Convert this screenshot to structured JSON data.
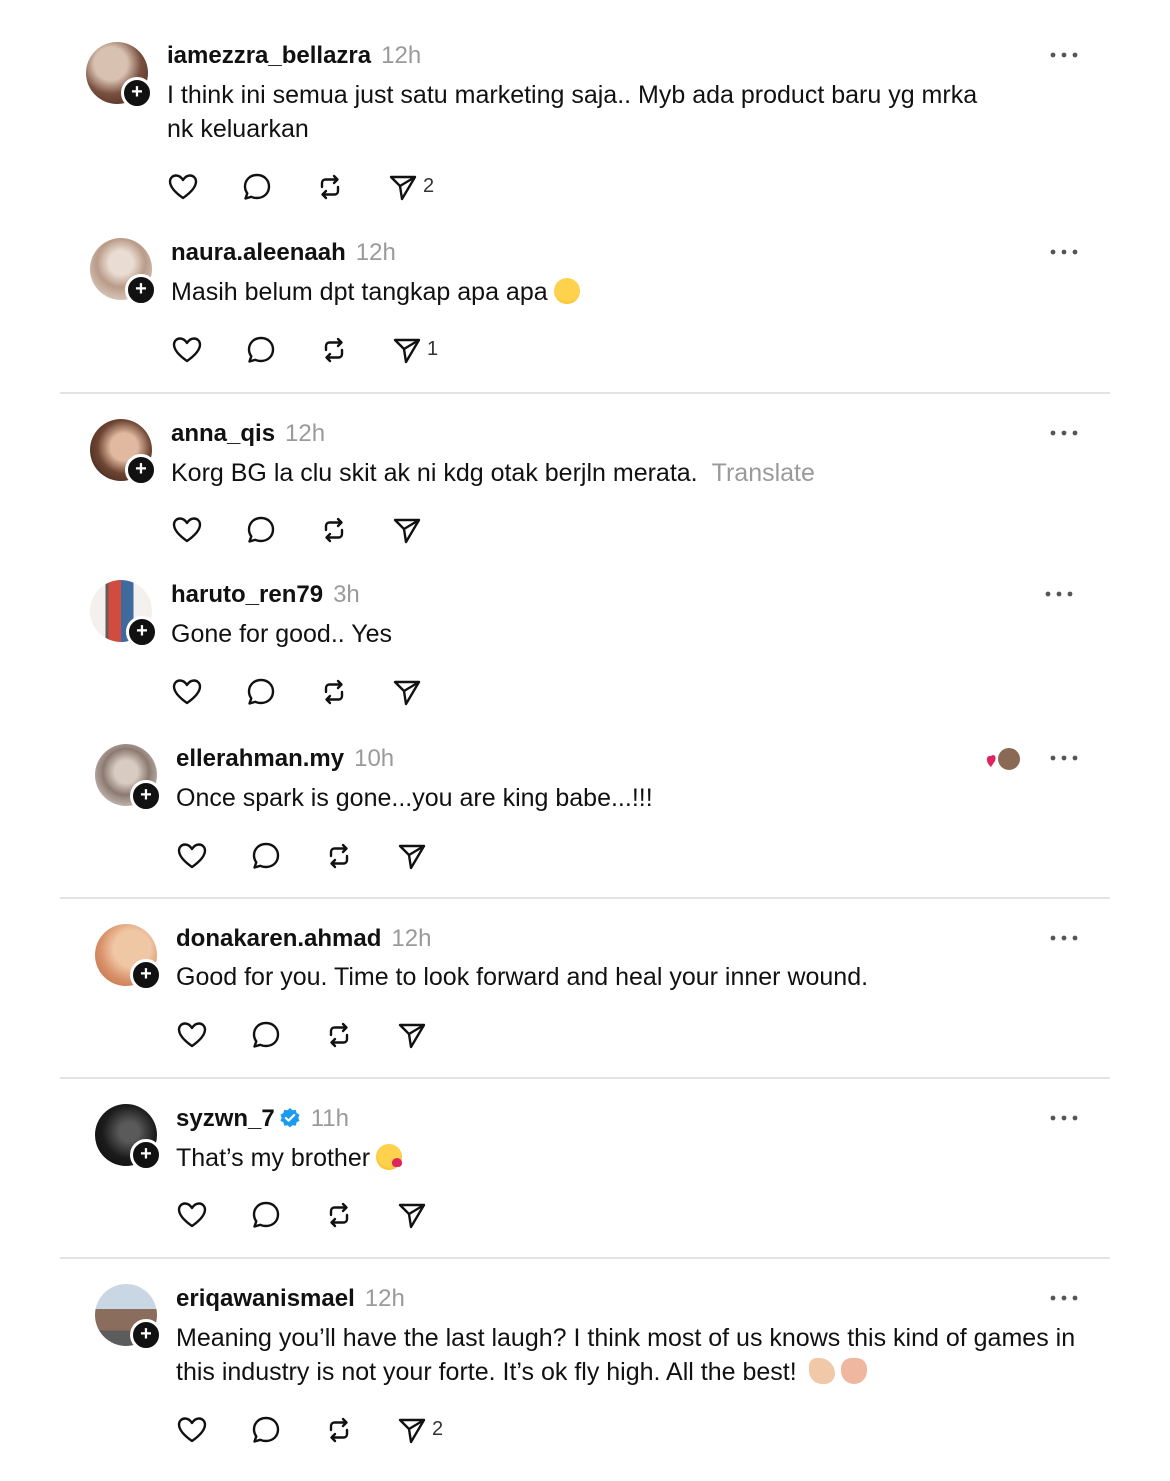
{
  "posts": [
    {
      "username": "iamezzra_bellazra",
      "time": "12h",
      "text": "I think ini semua just satu marketing saja.. Myb ada product baru yg mrka nk keluarkan",
      "share_count": "2"
    },
    {
      "username": "naura.aleenaah",
      "time": "12h",
      "text": "Masih belum dpt tangkap apa apa",
      "share_count": "1"
    },
    {
      "username": "anna_qis",
      "time": "12h",
      "text": "Korg BG la clu skit ak ni kdg otak berjln merata.",
      "translate": "Translate",
      "share_count": ""
    },
    {
      "username": "haruto_ren79",
      "time": "3h",
      "text": "Gone for good.. Yes",
      "share_count": ""
    },
    {
      "username": "ellerahman.my",
      "time": "10h",
      "text": "Once spark is gone...you are king babe...!!!",
      "share_count": ""
    },
    {
      "username": "donakaren.ahmad",
      "time": "12h",
      "text": "Good for you. Time to look forward and heal your inner wound.",
      "share_count": ""
    },
    {
      "username": "syzwn_7",
      "time": "11h",
      "text": "That’s my brother",
      "share_count": ""
    },
    {
      "username": "eriqawanismael",
      "time": "12h",
      "text": "Meaning you’ll have the last laugh? I think most of us knows this kind of games in this industry is not your forte. It’s ok fly high. All the best!",
      "share_count": "2"
    }
  ],
  "icons": {
    "like": "heart-icon",
    "reply": "comment-icon",
    "repost": "repost-icon",
    "share": "send-icon",
    "more": "more-icon",
    "follow": "plus-icon"
  },
  "colors": {
    "verified": "#1d9bf0",
    "muted": "#9a9a9a",
    "divider": "#e3e3e3"
  }
}
